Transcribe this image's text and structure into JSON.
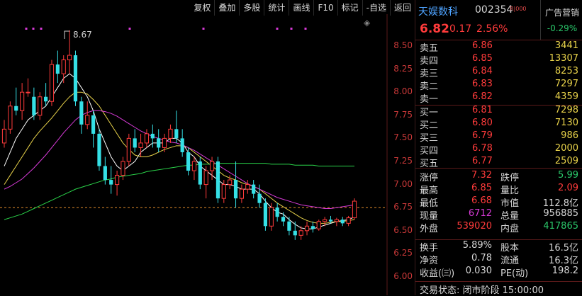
{
  "toolbar": [
    "复权",
    "叠加",
    "多股",
    "统计",
    "画线",
    "F10",
    "标记",
    "-自选",
    "返回"
  ],
  "chart": {
    "peak_label": "8.67",
    "y_ticks": [
      "8.50",
      "8.25",
      "8.00",
      "7.75",
      "7.50",
      "7.25",
      "7.00",
      "6.75",
      "6.50",
      "6.25",
      "6.00"
    ],
    "y_min": 6.0,
    "y_max": 8.5,
    "current_price_line": 6.75,
    "colors": {
      "up": "#ff3b3b",
      "down": "#35e0e6",
      "ma5": "#ffffff",
      "ma10": "#e8d24a",
      "ma20": "#d63ad6",
      "ma60": "#2ad44a"
    }
  },
  "chart_data": {
    "type": "candlestick",
    "candles": [
      [
        7.45,
        7.7,
        7.4,
        7.6
      ],
      [
        7.6,
        7.9,
        7.55,
        7.85
      ],
      [
        7.85,
        8.05,
        7.75,
        7.8
      ],
      [
        7.8,
        8.1,
        7.7,
        8.0
      ],
      [
        8.0,
        8.15,
        7.95,
        8.0
      ],
      [
        7.95,
        8.05,
        7.7,
        7.75
      ],
      [
        7.75,
        8.0,
        7.7,
        7.95
      ],
      [
        7.95,
        8.1,
        7.85,
        7.9
      ],
      [
        7.9,
        8.35,
        7.85,
        8.3
      ],
      [
        8.3,
        8.45,
        8.1,
        8.2
      ],
      [
        8.2,
        8.4,
        8.1,
        8.35
      ],
      [
        8.35,
        8.67,
        8.2,
        8.4
      ],
      [
        8.4,
        8.45,
        7.85,
        7.9
      ],
      [
        7.9,
        7.95,
        7.55,
        7.65
      ],
      [
        7.65,
        7.9,
        7.6,
        7.75
      ],
      [
        7.75,
        7.8,
        7.4,
        7.55
      ],
      [
        7.55,
        7.6,
        7.15,
        7.2
      ],
      [
        7.2,
        7.3,
        7.0,
        7.05
      ],
      [
        7.05,
        7.2,
        6.9,
        7.0
      ],
      [
        7.0,
        7.15,
        6.88,
        7.1
      ],
      [
        7.1,
        7.3,
        7.05,
        7.25
      ],
      [
        7.25,
        7.55,
        7.2,
        7.5
      ],
      [
        7.5,
        7.6,
        7.35,
        7.4
      ],
      [
        7.4,
        7.55,
        7.3,
        7.45
      ],
      [
        7.45,
        7.6,
        7.4,
        7.55
      ],
      [
        7.55,
        7.65,
        7.4,
        7.5
      ],
      [
        7.5,
        7.6,
        7.35,
        7.4
      ],
      [
        7.4,
        7.55,
        7.35,
        7.5
      ],
      [
        7.5,
        7.65,
        7.45,
        7.6
      ],
      [
        7.6,
        7.8,
        7.45,
        7.5
      ],
      [
        7.5,
        7.6,
        7.3,
        7.35
      ],
      [
        7.35,
        7.4,
        7.1,
        7.15
      ],
      [
        7.15,
        7.3,
        7.05,
        7.25
      ],
      [
        7.25,
        7.3,
        6.95,
        7.0
      ],
      [
        7.0,
        7.2,
        6.85,
        7.15
      ],
      [
        7.15,
        7.3,
        7.05,
        7.25
      ],
      [
        7.25,
        7.3,
        6.8,
        6.85
      ],
      [
        6.85,
        7.05,
        6.8,
        7.0
      ],
      [
        7.0,
        7.1,
        6.95,
        7.05
      ],
      [
        7.05,
        7.25,
        6.75,
        6.85
      ],
      [
        6.85,
        7.0,
        6.8,
        6.95
      ],
      [
        6.95,
        7.05,
        6.9,
        7.0
      ],
      [
        7.0,
        7.05,
        6.85,
        6.9
      ],
      [
        6.9,
        7.0,
        6.75,
        6.8
      ],
      [
        6.8,
        6.85,
        6.5,
        6.55
      ],
      [
        6.55,
        6.8,
        6.5,
        6.75
      ],
      [
        6.75,
        6.8,
        6.6,
        6.65
      ],
      [
        6.65,
        6.7,
        6.55,
        6.6
      ],
      [
        6.6,
        6.65,
        6.45,
        6.5
      ],
      [
        6.5,
        6.6,
        6.4,
        6.45
      ],
      [
        6.45,
        6.55,
        6.4,
        6.5
      ],
      [
        6.5,
        6.6,
        6.45,
        6.55
      ],
      [
        6.55,
        6.6,
        6.48,
        6.52
      ],
      [
        6.52,
        6.62,
        6.5,
        6.6
      ],
      [
        6.6,
        6.65,
        6.55,
        6.62
      ],
      [
        6.62,
        6.66,
        6.58,
        6.6
      ],
      [
        6.6,
        6.64,
        6.55,
        6.62
      ],
      [
        6.62,
        6.65,
        6.55,
        6.58
      ],
      [
        6.58,
        6.66,
        6.55,
        6.64
      ],
      [
        6.64,
        6.85,
        6.62,
        6.82
      ]
    ],
    "ma_lines": {
      "ma5": [
        7.2,
        7.35,
        7.5,
        7.6,
        7.7,
        7.75,
        7.8,
        7.85,
        7.95,
        8.05,
        8.15,
        8.2,
        8.15,
        8.05,
        7.95,
        7.8,
        7.6,
        7.45,
        7.3,
        7.2,
        7.15,
        7.2,
        7.25,
        7.35,
        7.4,
        7.45,
        7.45,
        7.45,
        7.5,
        7.5,
        7.45,
        7.35,
        7.3,
        7.2,
        7.15,
        7.1,
        7.05,
        7.0,
        7.0,
        6.98,
        6.95,
        6.95,
        6.95,
        6.9,
        6.82,
        6.75,
        6.7,
        6.68,
        6.62,
        6.57,
        6.53,
        6.52,
        6.52,
        6.54,
        6.56,
        6.58,
        6.6,
        6.61,
        6.62,
        6.65
      ],
      "ma10": [
        7.0,
        7.1,
        7.2,
        7.3,
        7.4,
        7.5,
        7.58,
        7.65,
        7.72,
        7.8,
        7.88,
        7.95,
        8.0,
        8.0,
        7.98,
        7.92,
        7.85,
        7.75,
        7.65,
        7.55,
        7.45,
        7.38,
        7.32,
        7.3,
        7.3,
        7.32,
        7.35,
        7.38,
        7.4,
        7.42,
        7.42,
        7.4,
        7.35,
        7.3,
        7.25,
        7.2,
        7.15,
        7.1,
        7.07,
        7.05,
        7.02,
        7.0,
        6.98,
        6.95,
        6.9,
        6.85,
        6.8,
        6.76,
        6.72,
        6.68,
        6.64,
        6.61,
        6.59,
        6.58,
        6.58,
        6.59,
        6.6,
        6.6,
        6.61,
        6.62
      ],
      "ma20": [
        6.95,
        6.98,
        7.02,
        7.06,
        7.12,
        7.18,
        7.25,
        7.32,
        7.4,
        7.48,
        7.56,
        7.63,
        7.7,
        7.75,
        7.78,
        7.8,
        7.8,
        7.79,
        7.77,
        7.74,
        7.7,
        7.66,
        7.62,
        7.58,
        7.55,
        7.52,
        7.5,
        7.48,
        7.46,
        7.45,
        7.43,
        7.4,
        7.37,
        7.33,
        7.29,
        7.25,
        7.21,
        7.17,
        7.13,
        7.09,
        7.05,
        7.01,
        6.98,
        6.95,
        6.92,
        6.89,
        6.86,
        6.84,
        6.82,
        6.8,
        6.78,
        6.77,
        6.76,
        6.75,
        6.74,
        6.74,
        6.75,
        6.76,
        6.77,
        6.78
      ],
      "ma60": [
        6.62,
        6.64,
        6.66,
        6.68,
        6.71,
        6.74,
        6.77,
        6.8,
        6.83,
        6.86,
        6.89,
        6.92,
        6.95,
        6.97,
        6.99,
        7.01,
        7.03,
        7.05,
        7.06,
        7.08,
        7.09,
        7.1,
        7.11,
        7.12,
        7.14,
        7.15,
        7.16,
        7.17,
        7.18,
        7.19,
        7.2,
        7.21,
        7.21,
        7.22,
        7.22,
        7.22,
        7.23,
        7.23,
        7.23,
        7.23,
        7.23,
        7.23,
        7.23,
        7.23,
        7.23,
        7.22,
        7.22,
        7.22,
        7.22,
        7.21,
        7.21,
        7.21,
        7.21,
        7.2,
        7.2,
        7.2,
        7.2,
        7.2,
        7.2,
        7.2
      ]
    }
  },
  "panel": {
    "name": "天娱数科",
    "code": "002354",
    "badge": "R|000",
    "ad_label": "广告营销",
    "ad_change": "-0.29%",
    "price": "6.82",
    "change": "0.17",
    "change_pct": "2.56%",
    "asks": [
      {
        "label": "卖五",
        "price": "6.86",
        "vol": "3441"
      },
      {
        "label": "卖四",
        "price": "6.85",
        "vol": "13307"
      },
      {
        "label": "卖三",
        "price": "6.84",
        "vol": "8253"
      },
      {
        "label": "卖二",
        "price": "6.83",
        "vol": "7297"
      },
      {
        "label": "卖一",
        "price": "6.82",
        "vol": "4359"
      }
    ],
    "bids": [
      {
        "label": "买一",
        "price": "6.81",
        "vol": "7298"
      },
      {
        "label": "买二",
        "price": "6.80",
        "vol": "7130"
      },
      {
        "label": "买三",
        "price": "6.79",
        "vol": "986"
      },
      {
        "label": "买四",
        "price": "6.78",
        "vol": "2000"
      },
      {
        "label": "买五",
        "price": "6.77",
        "vol": "2509"
      }
    ],
    "stats": [
      {
        "l1": "涨停",
        "v1": "7.32",
        "c1": "#ff3b3b",
        "l2": "跌停",
        "v2": "5.99",
        "c2": "#2ac76a"
      },
      {
        "l1": "最高",
        "v1": "6.85",
        "c1": "#ff3b3b",
        "l2": "量比",
        "v2": "2.09",
        "c2": "#ff3b3b"
      },
      {
        "l1": "最低",
        "v1": "6.68",
        "c1": "#ff3b3b",
        "l2": "市值",
        "v2": "112.8亿",
        "c2": "#d6d6d6"
      },
      {
        "l1": "现量",
        "v1": "6712",
        "c1": "#d63ad6",
        "l2": "总量",
        "v2": "956885",
        "c2": "#d6d6d6"
      },
      {
        "l1": "外盘",
        "v1": "539020",
        "c1": "#ff3b3b",
        "l2": "内盘",
        "v2": "417865",
        "c2": "#2ac76a"
      }
    ],
    "stats2": [
      {
        "l1": "换手",
        "v1": "5.89%",
        "c1": "#d6d6d6",
        "l2": "股本",
        "v2": "16.5亿",
        "c2": "#d6d6d6"
      },
      {
        "l1": "净资",
        "v1": "0.78",
        "c1": "#d6d6d6",
        "l2": "流通",
        "v2": "16.3亿",
        "c2": "#d6d6d6"
      },
      {
        "l1": "收益(㈢)",
        "v1": "0.030",
        "c1": "#d6d6d6",
        "l2": "PE(动)",
        "v2": "198.2",
        "c2": "#d6d6d6"
      }
    ],
    "footer": "交易状态: 闭市阶段 15:00:00"
  }
}
